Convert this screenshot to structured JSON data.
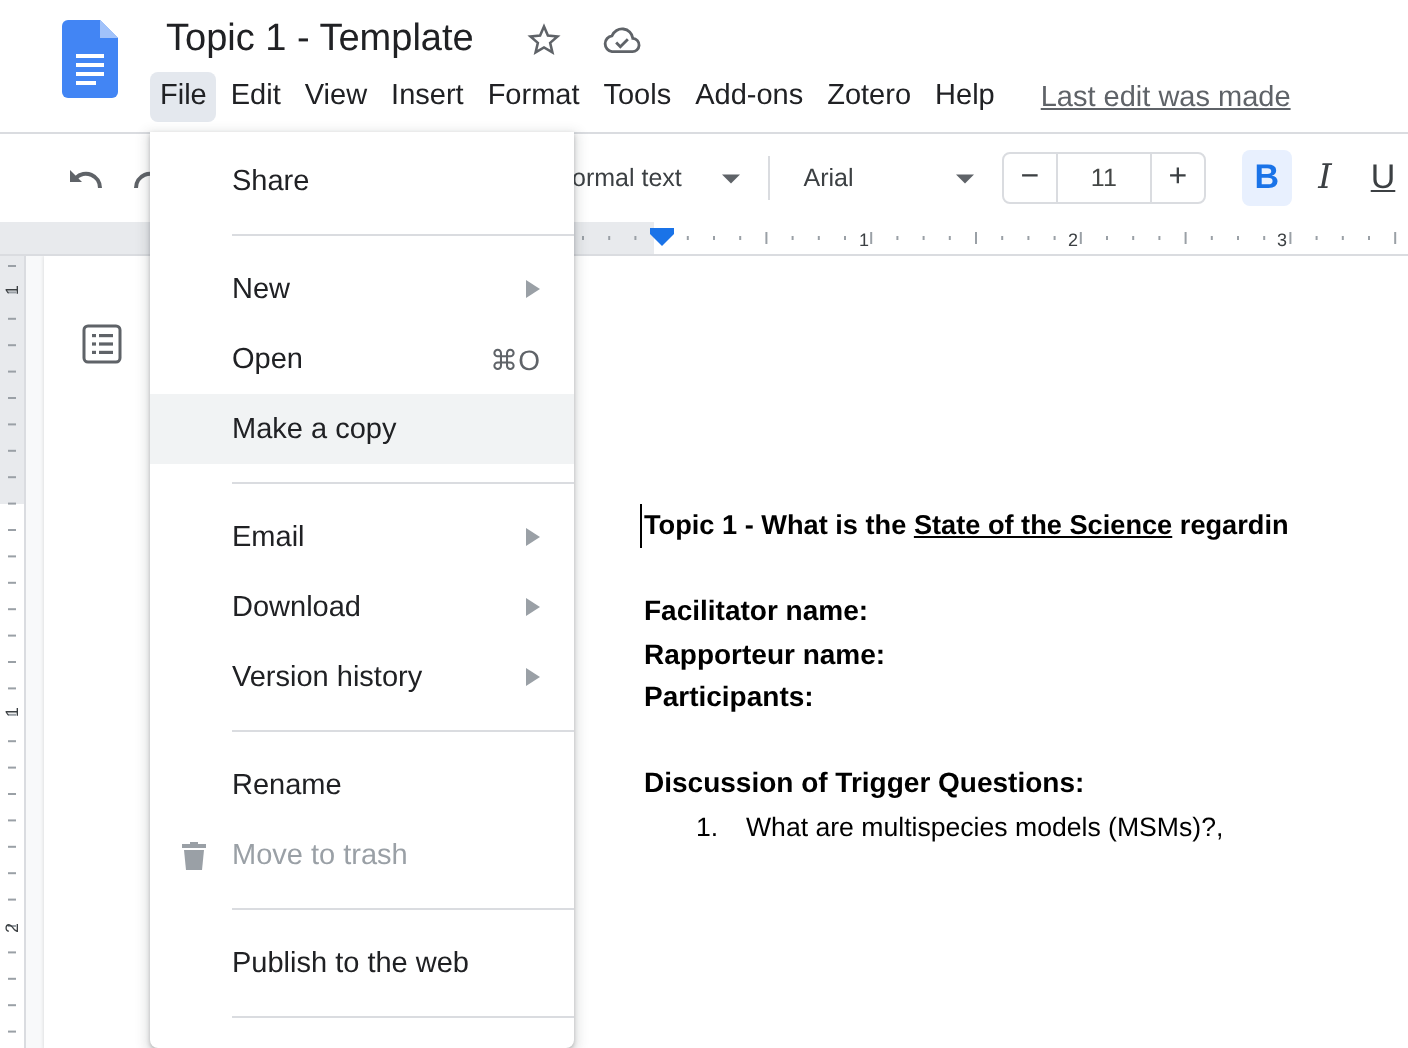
{
  "document_title": "Topic 1 - Template",
  "menu_bar": [
    {
      "label": "File",
      "selected": true
    },
    {
      "label": "Edit",
      "selected": false
    },
    {
      "label": "View",
      "selected": false
    },
    {
      "label": "Insert",
      "selected": false
    },
    {
      "label": "Format",
      "selected": false
    },
    {
      "label": "Tools",
      "selected": false
    },
    {
      "label": "Add-ons",
      "selected": false
    },
    {
      "label": "Zotero",
      "selected": false
    },
    {
      "label": "Help",
      "selected": false
    }
  ],
  "last_edit": "Last edit was made",
  "toolbar": {
    "style": "ormal text",
    "font": "Arial",
    "font_size": "11",
    "decrease": "−",
    "increase": "+",
    "bold": {
      "label": "B",
      "active": true
    },
    "italic": {
      "label": "I",
      "active": false
    },
    "underline": {
      "label": "U",
      "active": false
    }
  },
  "ruler_numbers": [
    "1",
    "2",
    "3"
  ],
  "vertical_ruler_numbers": [
    "1",
    "1",
    "2"
  ],
  "file_menu": [
    {
      "kind": "item",
      "label": "Share",
      "submenu": false,
      "highlighted": false,
      "disabled": false,
      "leading_icon": false
    },
    {
      "kind": "separator"
    },
    {
      "kind": "item",
      "label": "New",
      "submenu": true,
      "highlighted": false,
      "disabled": false,
      "leading_icon": false
    },
    {
      "kind": "item",
      "label": "Open",
      "shortcut": "⌘O",
      "submenu": false,
      "highlighted": false,
      "disabled": false,
      "leading_icon": false
    },
    {
      "kind": "item",
      "label": "Make a copy",
      "submenu": false,
      "highlighted": true,
      "disabled": false,
      "leading_icon": false
    },
    {
      "kind": "separator"
    },
    {
      "kind": "item",
      "label": "Email",
      "submenu": true,
      "highlighted": false,
      "disabled": false,
      "leading_icon": false
    },
    {
      "kind": "item",
      "label": "Download",
      "submenu": true,
      "highlighted": false,
      "disabled": false,
      "leading_icon": false
    },
    {
      "kind": "item",
      "label": "Version history",
      "submenu": true,
      "highlighted": false,
      "disabled": false,
      "leading_icon": false
    },
    {
      "kind": "separator"
    },
    {
      "kind": "item",
      "label": "Rename",
      "submenu": false,
      "highlighted": false,
      "disabled": false,
      "leading_icon": false
    },
    {
      "kind": "item",
      "label": "Move to trash",
      "submenu": false,
      "highlighted": false,
      "disabled": true,
      "leading_icon": true
    },
    {
      "kind": "separator"
    },
    {
      "kind": "item",
      "label": "Publish to the web",
      "submenu": false,
      "highlighted": false,
      "disabled": false,
      "leading_icon": false
    },
    {
      "kind": "separator"
    }
  ],
  "document": {
    "heading_before": "Topic 1 - What is the ",
    "heading_underlined": "State of the Science",
    "heading_after": " regardin",
    "fields": [
      "Facilitator name:",
      "Rapporteur name:",
      "Participants:"
    ],
    "section_title": "Discussion of Trigger Questions:",
    "questions": [
      {
        "number": "1.",
        "text": "What are multispecies models (MSMs)?,"
      }
    ]
  }
}
